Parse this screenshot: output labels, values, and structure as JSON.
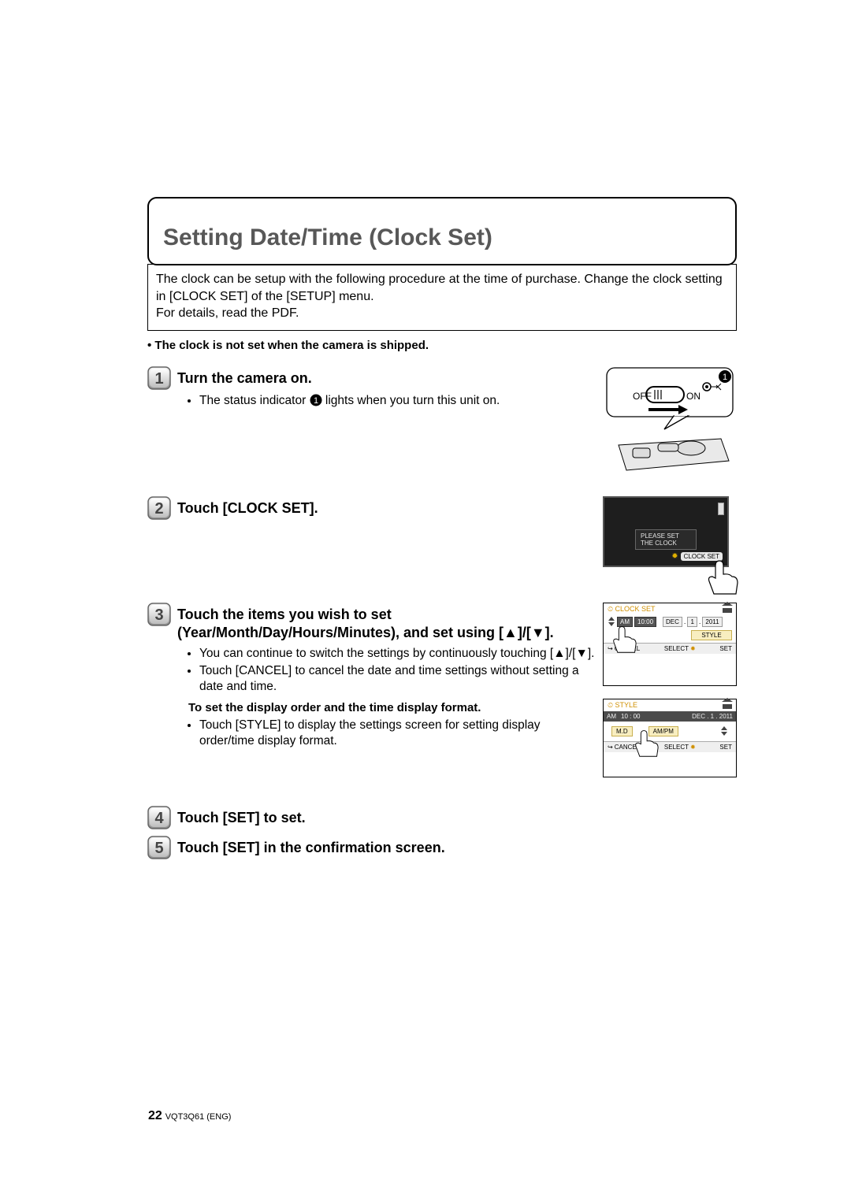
{
  "title": "Setting Date/Time (Clock Set)",
  "intro": "The clock can be setup with the following procedure at the time of purchase. Change the clock setting in [CLOCK SET] of the [SETUP] menu.\nFor details, read the PDF.",
  "note_bullet": "• The clock is not set when the camera is shipped.",
  "steps": {
    "s1": {
      "title": "Turn the camera on.",
      "bullet_pre": "The status indicator ",
      "bullet_post": " lights when you turn this unit on."
    },
    "s2": {
      "title": "Touch [CLOCK SET]."
    },
    "s3": {
      "title": "Touch the items you wish to set (Year/Month/Day/Hours/Minutes), and set using [▲]/[▼].",
      "b1": "You can continue to switch the settings by continuously touching [▲]/[▼].",
      "b2": "Touch [CANCEL] to cancel the date and time settings without setting a date and time.",
      "sub": "To set the display order and the time display format.",
      "b3": "Touch [STYLE] to display the settings screen for setting display order/time display format."
    },
    "s4": {
      "title": "Touch [SET] to set."
    },
    "s5": {
      "title": "Touch [SET] in the confirmation screen."
    }
  },
  "switch": {
    "off": "OFF",
    "on": "ON",
    "marker": "1"
  },
  "lcd1": {
    "message": "PLEASE SET THE CLOCK",
    "button": "CLOCK SET"
  },
  "panel1": {
    "header_icon": "⏲",
    "header": "CLOCK SET",
    "am": "AM",
    "time": "10:00",
    "mon": "DEC",
    "sep": ".",
    "day": "1",
    "year": "2011",
    "style": "STYLE",
    "cancel": "CANCEL",
    "select": "SELECT",
    "set": "SET"
  },
  "panel2": {
    "header_icon": "⏲",
    "header": "STYLE",
    "am": "AM",
    "time": "10 : 00",
    "date": "DEC .   1 . 2011",
    "mdy": "M.D",
    "ampm": "AM/PM",
    "cancel": "CANCEL",
    "select": "SELECT",
    "set": "SET"
  },
  "footer": {
    "page": "22",
    "code": "VQT3Q61 (ENG)"
  }
}
